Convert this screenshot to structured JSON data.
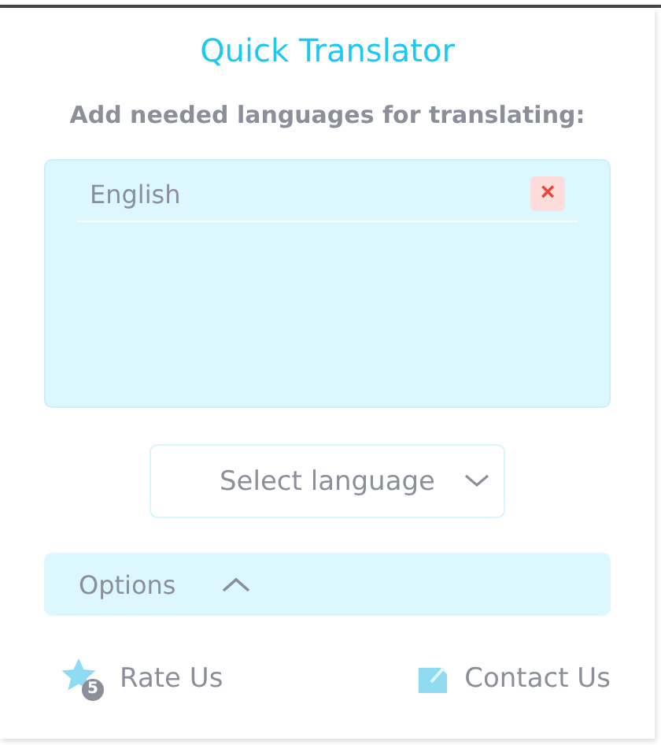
{
  "title": "Quick Translator",
  "subtitle": "Add needed languages for translating:",
  "languages": [
    {
      "name": "English",
      "remove_label": "×"
    }
  ],
  "select": {
    "placeholder": "Select language"
  },
  "options": {
    "label": "Options",
    "expanded": true
  },
  "footer": {
    "rate": {
      "label": "Rate Us",
      "badge": "5"
    },
    "contact": {
      "label": "Contact Us"
    }
  }
}
